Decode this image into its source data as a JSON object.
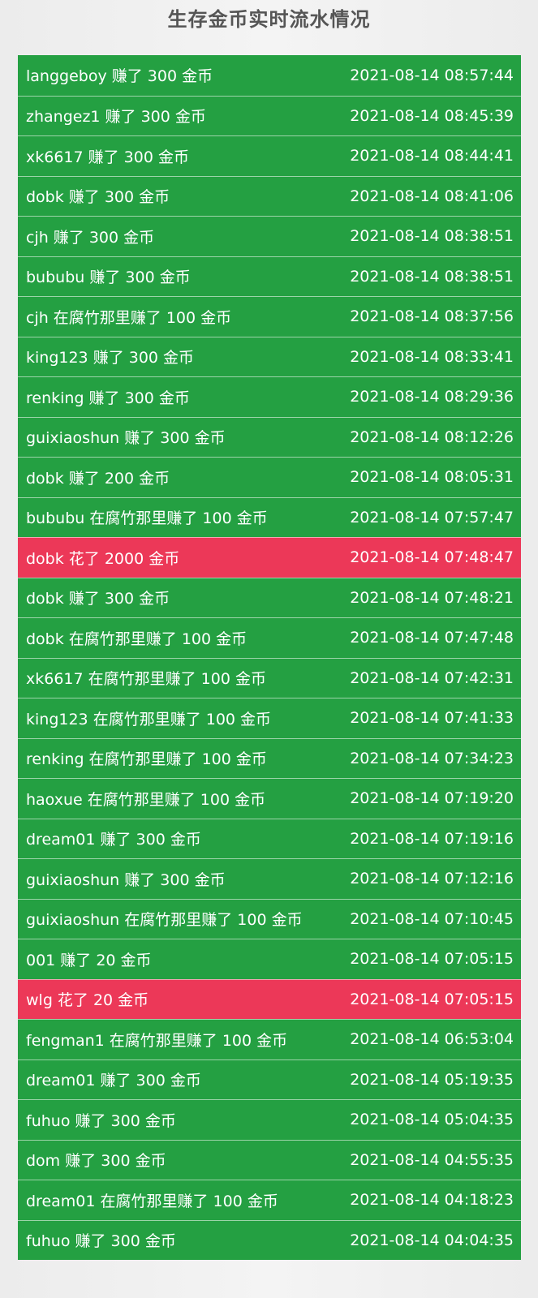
{
  "page": {
    "title": "生存金币实时流水情况"
  },
  "colors": {
    "earn": "#24a042",
    "spend": "#ec3858",
    "title": "#555555",
    "background": "#efefef"
  },
  "records": [
    {
      "text": "langgeboy 赚了 300 金币",
      "time": "2021-08-14 08:57:44",
      "type": "earn"
    },
    {
      "text": "zhangez1 赚了 300 金币",
      "time": "2021-08-14 08:45:39",
      "type": "earn"
    },
    {
      "text": "xk6617 赚了 300 金币",
      "time": "2021-08-14 08:44:41",
      "type": "earn"
    },
    {
      "text": "dobk 赚了 300 金币",
      "time": "2021-08-14 08:41:06",
      "type": "earn"
    },
    {
      "text": "cjh 赚了 300 金币",
      "time": "2021-08-14 08:38:51",
      "type": "earn"
    },
    {
      "text": "bububu 赚了 300 金币",
      "time": "2021-08-14 08:38:51",
      "type": "earn"
    },
    {
      "text": "cjh 在腐竹那里赚了 100 金币",
      "time": "2021-08-14 08:37:56",
      "type": "earn"
    },
    {
      "text": "king123 赚了 300 金币",
      "time": "2021-08-14 08:33:41",
      "type": "earn"
    },
    {
      "text": "renking 赚了 300 金币",
      "time": "2021-08-14 08:29:36",
      "type": "earn"
    },
    {
      "text": "guixiaoshun 赚了 300 金币",
      "time": "2021-08-14 08:12:26",
      "type": "earn"
    },
    {
      "text": "dobk 赚了 200 金币",
      "time": "2021-08-14 08:05:31",
      "type": "earn"
    },
    {
      "text": "bububu 在腐竹那里赚了 100 金币",
      "time": "2021-08-14 07:57:47",
      "type": "earn"
    },
    {
      "text": "dobk 花了 2000 金币",
      "time": "2021-08-14 07:48:47",
      "type": "spend"
    },
    {
      "text": "dobk 赚了 300 金币",
      "time": "2021-08-14 07:48:21",
      "type": "earn"
    },
    {
      "text": "dobk 在腐竹那里赚了 100 金币",
      "time": "2021-08-14 07:47:48",
      "type": "earn"
    },
    {
      "text": "xk6617 在腐竹那里赚了 100 金币",
      "time": "2021-08-14 07:42:31",
      "type": "earn"
    },
    {
      "text": "king123 在腐竹那里赚了 100 金币",
      "time": "2021-08-14 07:41:33",
      "type": "earn"
    },
    {
      "text": "renking 在腐竹那里赚了 100 金币",
      "time": "2021-08-14 07:34:23",
      "type": "earn"
    },
    {
      "text": "haoxue 在腐竹那里赚了 100 金币",
      "time": "2021-08-14 07:19:20",
      "type": "earn"
    },
    {
      "text": "dream01 赚了 300 金币",
      "time": "2021-08-14 07:19:16",
      "type": "earn"
    },
    {
      "text": "guixiaoshun 赚了 300 金币",
      "time": "2021-08-14 07:12:16",
      "type": "earn"
    },
    {
      "text": "guixiaoshun 在腐竹那里赚了 100 金币",
      "time": "2021-08-14 07:10:45",
      "type": "earn"
    },
    {
      "text": "001 赚了 20 金币",
      "time": "2021-08-14 07:05:15",
      "type": "earn"
    },
    {
      "text": "wlg 花了 20 金币",
      "time": "2021-08-14 07:05:15",
      "type": "spend"
    },
    {
      "text": "fengman1 在腐竹那里赚了 100 金币",
      "time": "2021-08-14 06:53:04",
      "type": "earn"
    },
    {
      "text": "dream01 赚了 300 金币",
      "time": "2021-08-14 05:19:35",
      "type": "earn"
    },
    {
      "text": "fuhuo 赚了 300 金币",
      "time": "2021-08-14 05:04:35",
      "type": "earn"
    },
    {
      "text": "dom 赚了 300 金币",
      "time": "2021-08-14 04:55:35",
      "type": "earn"
    },
    {
      "text": "dream01 在腐竹那里赚了 100 金币",
      "time": "2021-08-14 04:18:23",
      "type": "earn"
    },
    {
      "text": "fuhuo 赚了 300 金币",
      "time": "2021-08-14 04:04:35",
      "type": "earn"
    }
  ]
}
